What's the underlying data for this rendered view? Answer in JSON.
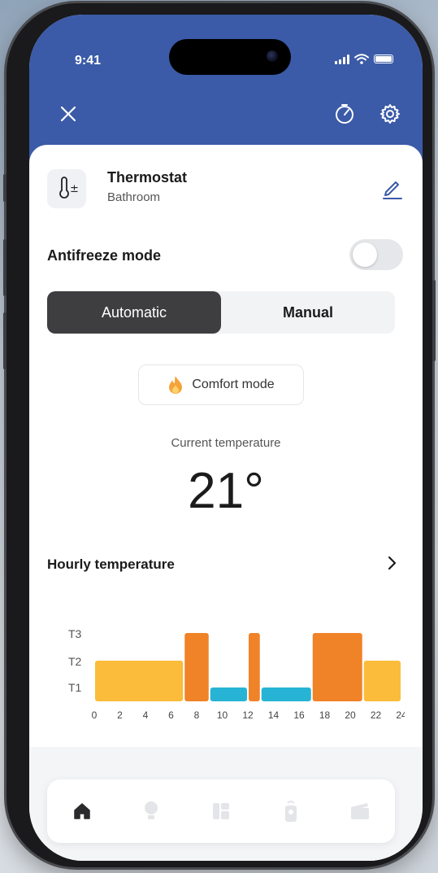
{
  "status_bar": {
    "time": "9:41"
  },
  "device": {
    "title": "Thermostat",
    "location": "Bathroom",
    "icon_glyph": "±"
  },
  "antifreeze": {
    "label": "Antifreeze mode",
    "enabled": false
  },
  "mode_tabs": {
    "automatic": "Automatic",
    "manual": "Manual",
    "selected": "Automatic"
  },
  "comfort": {
    "label": "Comfort mode"
  },
  "current": {
    "label": "Current temperature",
    "value": "21°"
  },
  "hourly": {
    "title": "Hourly temperature"
  },
  "colors": {
    "header": "#3b5ba8",
    "T1": "#27b4d4",
    "T2": "#fbbc3c",
    "T3": "#f08228",
    "active_tab": "#3e3e40"
  },
  "chart_data": {
    "type": "bar",
    "levels": [
      "T1",
      "T2",
      "T3"
    ],
    "x_ticks": [
      "0",
      "2",
      "4",
      "6",
      "8",
      "10",
      "12",
      "14",
      "16",
      "18",
      "20",
      "22",
      "24"
    ],
    "x_range": [
      0,
      24
    ],
    "segments": [
      {
        "start": 0,
        "end": 7,
        "level": "T2"
      },
      {
        "start": 7,
        "end": 9,
        "level": "T3"
      },
      {
        "start": 9,
        "end": 12,
        "level": "T1"
      },
      {
        "start": 12,
        "end": 13,
        "level": "T3"
      },
      {
        "start": 13,
        "end": 17,
        "level": "T1"
      },
      {
        "start": 17,
        "end": 21,
        "level": "T3"
      },
      {
        "start": 21,
        "end": 24,
        "level": "T2"
      }
    ]
  },
  "tab_bar": [
    "home-icon",
    "bulb-icon",
    "dashboard-icon",
    "remote-icon",
    "scene-icon"
  ]
}
